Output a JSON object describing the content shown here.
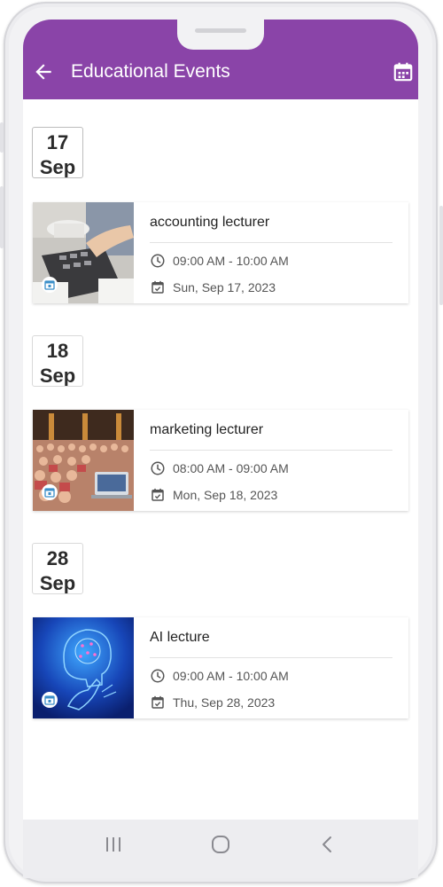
{
  "app_bar": {
    "title": "Educational Events",
    "back_icon": "arrow-left-icon",
    "calendar_icon": "calendar-icon",
    "color": "#8a44a8"
  },
  "events": [
    {
      "day": "17",
      "month": "Sep",
      "title": "accounting lecturer",
      "time": "09:00 AM - 10:00 AM",
      "date": "Sun, Sep 17, 2023",
      "image": "calculator-hands-photo"
    },
    {
      "day": "18",
      "month": "Sep",
      "title": "marketing lecturer",
      "time": "08:00 AM - 09:00 AM",
      "date": "Mon, Sep 18, 2023",
      "image": "lecture-hall-audience-photo"
    },
    {
      "day": "28",
      "month": "Sep",
      "title": "AI lecture",
      "time": "09:00 AM - 10:00 AM",
      "date": "Thu, Sep 28, 2023",
      "image": "ai-brain-hand-illustration"
    }
  ],
  "nav_bar": {
    "recents_icon": "recents-icon",
    "home_icon": "home-icon",
    "back_icon": "nav-back-icon"
  }
}
